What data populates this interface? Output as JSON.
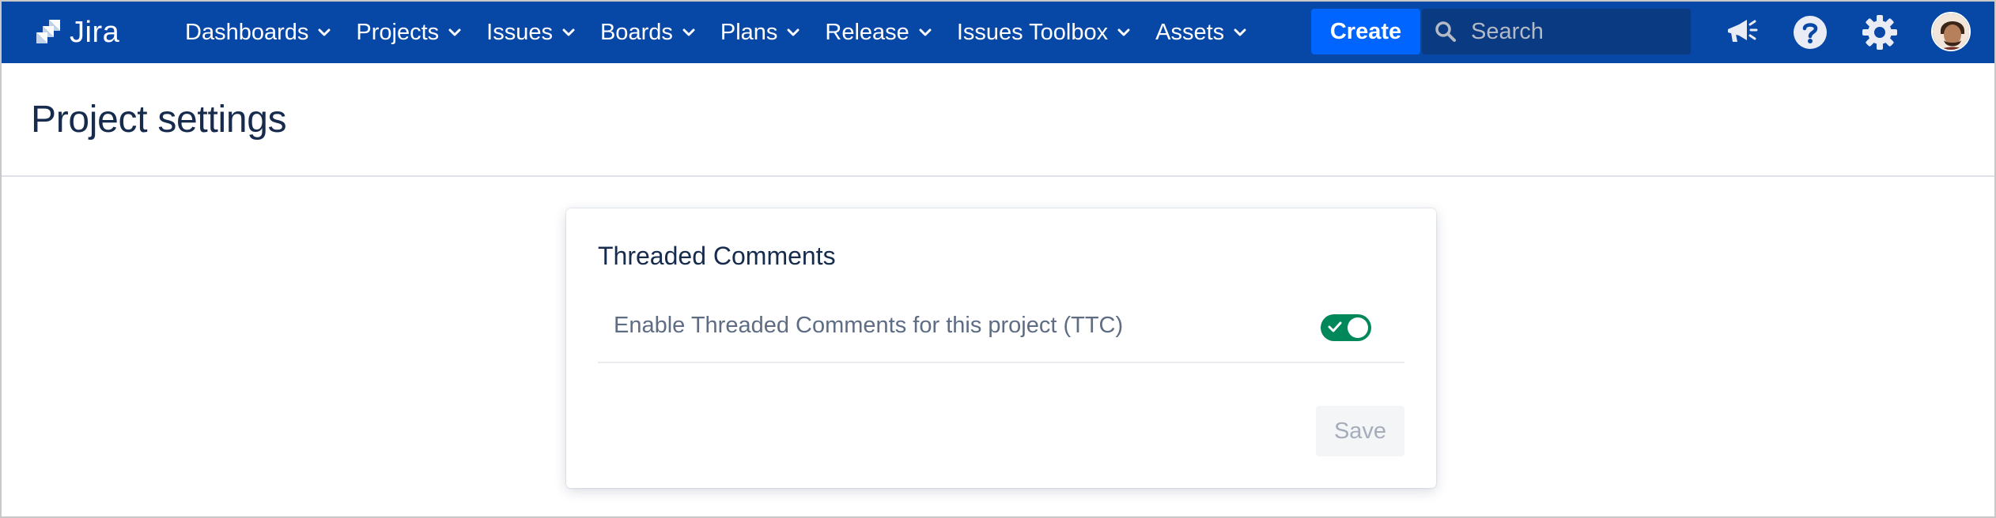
{
  "app": {
    "name": "Jira"
  },
  "colors": {
    "nav_bg": "#0747a6",
    "create_bg": "#0065ff",
    "search_bg": "#0a3a82",
    "toggle_on": "#00875a",
    "text_primary": "#172b4d",
    "text_subtle": "#5e6c84"
  },
  "nav": {
    "items": [
      {
        "label": "Dashboards",
        "icon": "chevron-down-icon"
      },
      {
        "label": "Projects",
        "icon": "chevron-down-icon"
      },
      {
        "label": "Issues",
        "icon": "chevron-down-icon"
      },
      {
        "label": "Boards",
        "icon": "chevron-down-icon"
      },
      {
        "label": "Plans",
        "icon": "chevron-down-icon"
      },
      {
        "label": "Release",
        "icon": "chevron-down-icon"
      },
      {
        "label": "Issues Toolbox",
        "icon": "chevron-down-icon"
      },
      {
        "label": "Assets",
        "icon": "chevron-down-icon"
      }
    ],
    "create_label": "Create",
    "search": {
      "placeholder": "Search",
      "value": ""
    },
    "right_icons": [
      "megaphone-icon",
      "help-icon",
      "gear-icon",
      "avatar"
    ]
  },
  "page": {
    "title": "Project settings"
  },
  "card": {
    "title": "Threaded Comments",
    "setting": {
      "label": "Enable Threaded Comments for this project (TTC)",
      "enabled": true
    },
    "save_label": "Save",
    "save_disabled": true
  }
}
